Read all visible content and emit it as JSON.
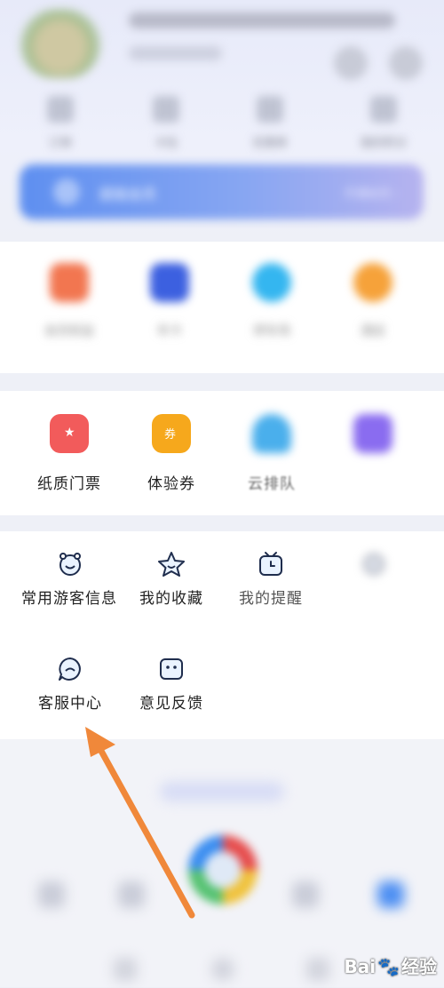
{
  "header": {
    "username": "",
    "quick": [
      {
        "label": "订单",
        "icon": "order-icon"
      },
      {
        "label": "卡包",
        "icon": "card-icon"
      },
      {
        "label": "优惠券",
        "icon": "coupon-icon"
      },
      {
        "label": "我的积分",
        "icon": "points-icon"
      }
    ],
    "member_banner": {
      "title": "超级会员",
      "action": "开通会员 ›"
    }
  },
  "services": [
    {
      "label": "会员权益",
      "icon": "gift-icon",
      "color": "#f27650"
    },
    {
      "label": "年卡",
      "icon": "yearcard-icon",
      "color": "#3c60e0"
    },
    {
      "label": "停车场",
      "icon": "parking-icon",
      "color": "#34b6f0"
    },
    {
      "label": "酒店",
      "icon": "hotel-icon",
      "color": "#f6a23a"
    }
  ],
  "tickets": [
    {
      "label": "纸质门票",
      "icon": "paper-ticket-icon",
      "color": "#f25b5b"
    },
    {
      "label": "体验券",
      "icon": "experience-voucher-icon",
      "color": "#f6a81c"
    },
    {
      "label": "云排队",
      "icon": "cloud-queue-icon",
      "color": "#4aafec"
    },
    {
      "label": "",
      "icon": "purple-card-icon",
      "color": "#8a6cf0"
    }
  ],
  "tools": [
    {
      "label": "常用游客信息",
      "icon": "face-icon"
    },
    {
      "label": "我的收藏",
      "icon": "star-icon"
    },
    {
      "label": "我的提醒",
      "icon": "clock-icon"
    },
    {
      "label": "",
      "icon": "settings-icon"
    },
    {
      "label": "客服中心",
      "icon": "service-chat-icon"
    },
    {
      "label": "意见反馈",
      "icon": "feedback-icon"
    }
  ],
  "tabbar": [
    {
      "label": "",
      "icon": "home-icon"
    },
    {
      "label": "",
      "icon": "discover-icon"
    },
    {
      "label": "",
      "icon": "center-icon"
    },
    {
      "label": "",
      "icon": "message-icon"
    },
    {
      "label": "",
      "icon": "mine-icon"
    }
  ],
  "watermark": {
    "text_left": "Bai",
    "text_right": "经验"
  },
  "colors": {
    "arrow": "#f0883a",
    "brand_blue": "#5e8ff0"
  }
}
